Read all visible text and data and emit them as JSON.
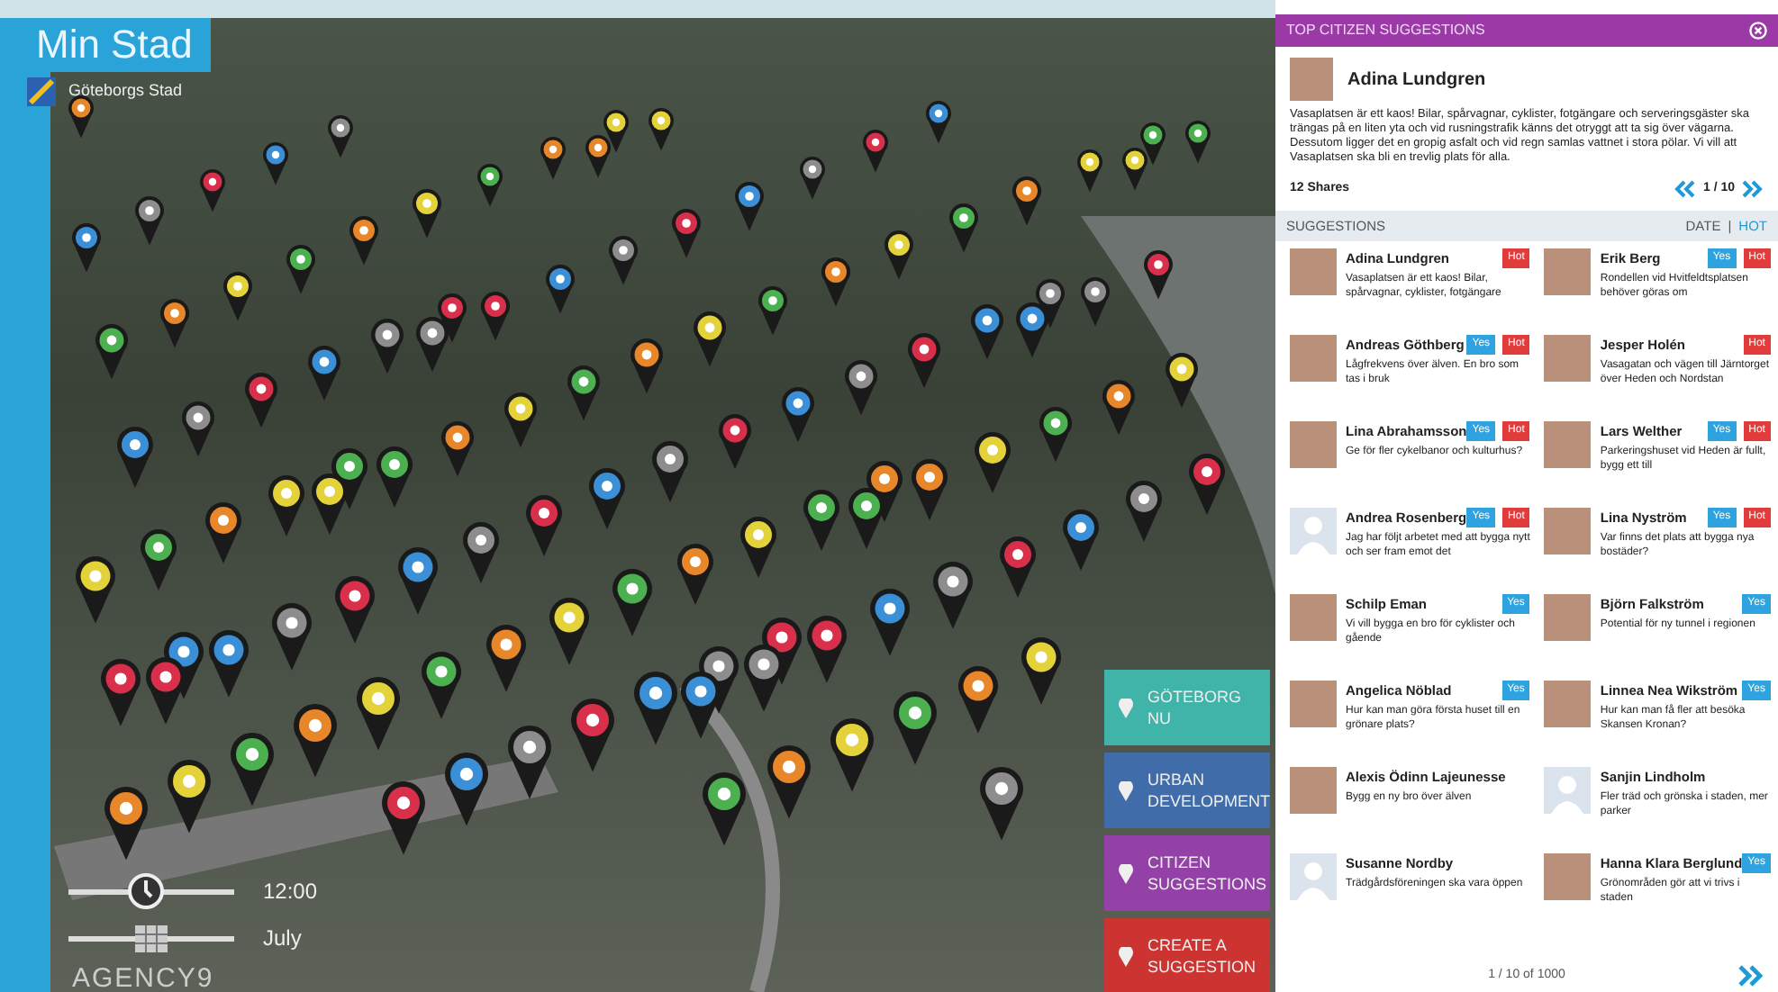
{
  "app": {
    "title": "Min Stad",
    "city": "Göteborgs Stad",
    "brand": "AGENCY9"
  },
  "timeline": {
    "time": {
      "value": "12:00",
      "level": 0.45
    },
    "month": {
      "value": "July",
      "level": 0.5
    }
  },
  "categories": [
    {
      "label": "GÖTEBORG NU",
      "color": "#3fbfb4"
    },
    {
      "label": "URBAN DEVELOPMENT",
      "color": "#3f6fb5"
    },
    {
      "label": "CITIZEN SUGGESTIONS",
      "color": "#9a3fb0"
    },
    {
      "label": "CREATE A SUGGESTION",
      "color": "#d9302e"
    }
  ],
  "panel": {
    "title": "TOP CITIZEN SUGGESTIONS",
    "featured": {
      "name": "Adina Lundgren",
      "text": "Vasaplatsen är ett kaos! Bilar, spårvagnar, cyklister, fotgängare och serveringsgäster ska trängas på en liten yta och vid rusningstrafik känns det otryggt att ta sig över vägarna. Dessutom ligger det en gropig asfalt och vid regn samlas vattnet i stora pölar. Vi vill att Vasaplatsen ska bli en trevlig plats för alla.",
      "shares": "12 Shares",
      "page": "1 / 10"
    },
    "section": "SUGGESTIONS",
    "sort": [
      {
        "label": "DATE",
        "selected": false
      },
      {
        "label": "HOT",
        "selected": true
      }
    ],
    "sort_separator": "|",
    "items": [
      {
        "name": "Adina Lundgren",
        "kind": "photo",
        "text": "Vasaplatsen är ett kaos! Bilar, spårvagnar, cyklister, fotgängare",
        "tags": [
          {
            "kind": "hot",
            "label": "Hot"
          }
        ]
      },
      {
        "name": "Erik Berg",
        "kind": "photo",
        "text": "Rondellen vid Hvitfeldtsplatsen behöver göras om",
        "tags": [
          {
            "kind": "yes",
            "label": "Yes"
          },
          {
            "kind": "hot",
            "label": "Hot"
          }
        ]
      },
      {
        "name": "Andreas Göthberg",
        "kind": "photo",
        "text": "Lågfrekvens över älven. En bro som tas i bruk",
        "tags": [
          {
            "kind": "yes",
            "label": "Yes"
          },
          {
            "kind": "hot",
            "label": "Hot"
          }
        ]
      },
      {
        "name": "Jesper Holén",
        "kind": "photo",
        "text": "Vasagatan och vägen till Järntorget över Heden och Nordstan",
        "tags": [
          {
            "kind": "hot",
            "label": "Hot"
          }
        ]
      },
      {
        "name": "Lina Abrahamsson",
        "kind": "photo",
        "text": "Ge för fler cykelbanor och kulturhus?",
        "tags": [
          {
            "kind": "yes",
            "label": "Yes"
          },
          {
            "kind": "hot",
            "label": "Hot"
          }
        ]
      },
      {
        "name": "Lars Welther",
        "kind": "photo",
        "text": "Parkeringshuset vid Heden är fullt, bygg ett till",
        "tags": [
          {
            "kind": "yes",
            "label": "Yes"
          },
          {
            "kind": "hot",
            "label": "Hot"
          }
        ]
      },
      {
        "name": "Andrea Rosenberg",
        "kind": "default",
        "text": "Jag har följt arbetet med att bygga nytt och ser fram emot det",
        "tags": [
          {
            "kind": "yes",
            "label": "Yes"
          },
          {
            "kind": "hot",
            "label": "Hot"
          }
        ]
      },
      {
        "name": "Lina Nyström",
        "kind": "photo",
        "text": "Var finns det plats att bygga nya bostäder?",
        "tags": [
          {
            "kind": "yes",
            "label": "Yes"
          },
          {
            "kind": "hot",
            "label": "Hot"
          }
        ]
      },
      {
        "name": "Schilp Eman",
        "kind": "photo",
        "text": "Vi vill bygga en bro för cyklister och gående",
        "tags": [
          {
            "kind": "yes",
            "label": "Yes"
          }
        ]
      },
      {
        "name": "Björn Falkström",
        "kind": "photo",
        "text": "Potential för ny tunnel i regionen",
        "tags": [
          {
            "kind": "yes",
            "label": "Yes"
          }
        ]
      },
      {
        "name": "Angelica Nöblad",
        "kind": "photo",
        "text": "Hur kan man göra första huset till en grönare plats?",
        "tags": [
          {
            "kind": "yes",
            "label": "Yes"
          }
        ]
      },
      {
        "name": "Linnea Nea Wikström",
        "kind": "photo",
        "text": "Hur kan man få fler att besöka Skansen Kronan?",
        "tags": [
          {
            "kind": "yes",
            "label": "Yes"
          }
        ]
      },
      {
        "name": "Alexis Ödinn Lajeunesse",
        "kind": "photo",
        "text": "Bygg en ny bro över älven"
      },
      {
        "name": "Sanjin Lindholm",
        "kind": "default",
        "text": "Fler träd och grönska i staden, mer parker"
      },
      {
        "name": "Susanne Nordby",
        "kind": "default",
        "text": "Trädgårdsföreningen ska vara öppen"
      },
      {
        "name": "Hanna Klara Berglund",
        "kind": "photo",
        "text": "Grönområden gör att vi trivs i staden",
        "tags": [
          {
            "kind": "yes",
            "label": "Yes"
          }
        ]
      }
    ],
    "footer": "1 / 10 of 1000"
  }
}
